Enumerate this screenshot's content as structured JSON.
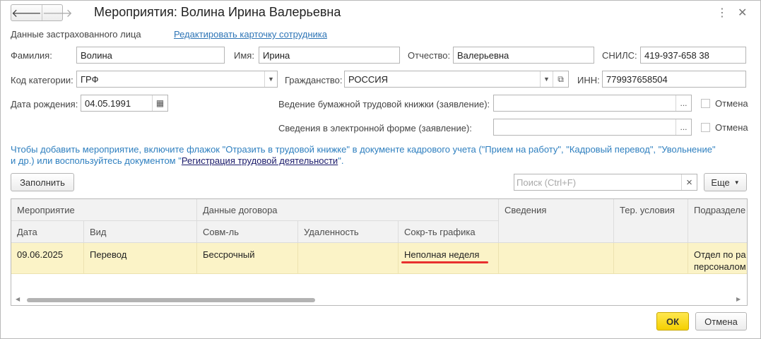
{
  "window": {
    "title": "Мероприятия: Волина Ирина Валерьевна",
    "more_icon": "⋮",
    "close_icon": "✕"
  },
  "nav": {
    "back_icon": "🡐",
    "forward_icon": "🡒"
  },
  "header": {
    "insured_label": "Данные застрахованного лица",
    "edit_link": "Редактировать карточку сотрудника"
  },
  "person": {
    "surname_label": "Фамилия:",
    "surname": "Волина",
    "name_label": "Имя:",
    "name": "Ирина",
    "patronymic_label": "Отчество:",
    "patronymic": "Валерьевна",
    "snils_label": "СНИЛС:",
    "snils": "419-937-658 38",
    "category_label": "Код категории:",
    "category": "ГРФ",
    "citizenship_label": "Гражданство:",
    "citizenship": "РОССИЯ",
    "inn_label": "ИНН:",
    "inn": "779937658504",
    "birthdate_label": "Дата рождения:",
    "birthdate": "04.05.1991"
  },
  "statements": {
    "paper_label": "Ведение бумажной трудовой книжки (заявление):",
    "electronic_label": "Сведения в электронной форме (заявление):",
    "cancel_label": "Отмена",
    "select_btn": "..."
  },
  "info": {
    "text_1": "Чтобы добавить мероприятие, включите флажок \"Отразить в трудовой книжке\" в документе кадрового учета (\"Прием на работу\", \"Кадровый перевод\", \"Увольнение\"",
    "text_2": "и др.) или воспользуйтесь документом \"",
    "link": "Регистрация трудовой деятельности",
    "text_3": "\"."
  },
  "toolbar": {
    "fill_label": "Заполнить",
    "search_placeholder": "Поиск (Ctrl+F)",
    "clear_icon": "×",
    "more_label": "Еще"
  },
  "table": {
    "group_headers": {
      "event": "Мероприятие",
      "contract": "Данные договора",
      "info": "Сведения",
      "terr": "Тер. условия",
      "dept": "Подразделе"
    },
    "sub_headers": {
      "date": "Дата",
      "type": "Вид",
      "combo": "Совм-ль",
      "remote": "Удаленность",
      "schedule": "Сокр-ть графика"
    },
    "row": {
      "date": "09.06.2025",
      "type": "Перевод",
      "combo": "Бессрочный",
      "remote": "",
      "schedule": "Неполная неделя",
      "info": "",
      "terr": "",
      "dept_1": "Отдел по ра",
      "dept_2": "персоналом"
    }
  },
  "footer": {
    "ok_label": "ОК",
    "cancel_label": "Отмена"
  },
  "colors": {
    "accent_yellow": "#f4d000",
    "link_blue": "#2e75b6",
    "row_highlight": "#fbf3c7",
    "marker_red": "#e8302e"
  }
}
